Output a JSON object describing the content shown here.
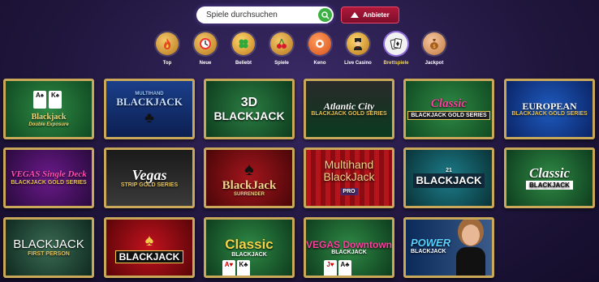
{
  "search": {
    "placeholder": "Spiele durchsuchen"
  },
  "provider_button": {
    "label": "Anbieter"
  },
  "categories": [
    {
      "label": "Top",
      "icon": "fire-icon"
    },
    {
      "label": "Neue",
      "icon": "clock-icon"
    },
    {
      "label": "Beliebt",
      "icon": "clover-icon"
    },
    {
      "label": "Spiele",
      "icon": "cherries-icon"
    },
    {
      "label": "Keno",
      "icon": "keno-ball-icon"
    },
    {
      "label": "Live Casino",
      "icon": "dealer-icon"
    },
    {
      "label": "Brettspiele",
      "icon": "cards-icon",
      "active": true
    },
    {
      "label": "Jackpot",
      "icon": "money-bag-icon"
    }
  ],
  "games": [
    {
      "line1": "Blackjack",
      "line2": "Double Exposure"
    },
    {
      "line1": "BLACKJACK",
      "line2": "MULTIHAND"
    },
    {
      "line1": "3D",
      "line2": "BLACKJACK"
    },
    {
      "line1": "Atlantic City",
      "line2": "BLACKJACK GOLD SERIES"
    },
    {
      "line1": "Classic",
      "line2": "BLACKJACK GOLD SERIES"
    },
    {
      "line1": "EUROPEAN",
      "line2": "BLACKJACK GOLD SERIES"
    },
    {
      "line1": "VEGAS Single Deck",
      "line2": "BLACKJACK GOLD SERIES"
    },
    {
      "line1": "Vegas",
      "line2": "STRIP GOLD SERIES"
    },
    {
      "line1": "BlackJack",
      "line2": "SURRENDER"
    },
    {
      "line1": "Multihand BlackJack",
      "line2": "PRO"
    },
    {
      "line1": "BLACKJACK",
      "line2": "21"
    },
    {
      "line1": "Classic",
      "line2": "BLACKJACK"
    },
    {
      "line1": "BLACKJACK",
      "line2": "FIRST PERSON"
    },
    {
      "line1": "BLACKJACK",
      "line2": ""
    },
    {
      "line1": "Classic",
      "line2": "BLACKJACK"
    },
    {
      "line1": "VEGAS Downtown",
      "line2": "BLACKJACK"
    },
    {
      "line1": "POWER",
      "line2": "BLACKJACK"
    }
  ],
  "colors": {
    "accent": "#3cb043",
    "provider": "#b0183a",
    "active_label": "#f5d94a",
    "tile_border": "#c9a85a"
  }
}
